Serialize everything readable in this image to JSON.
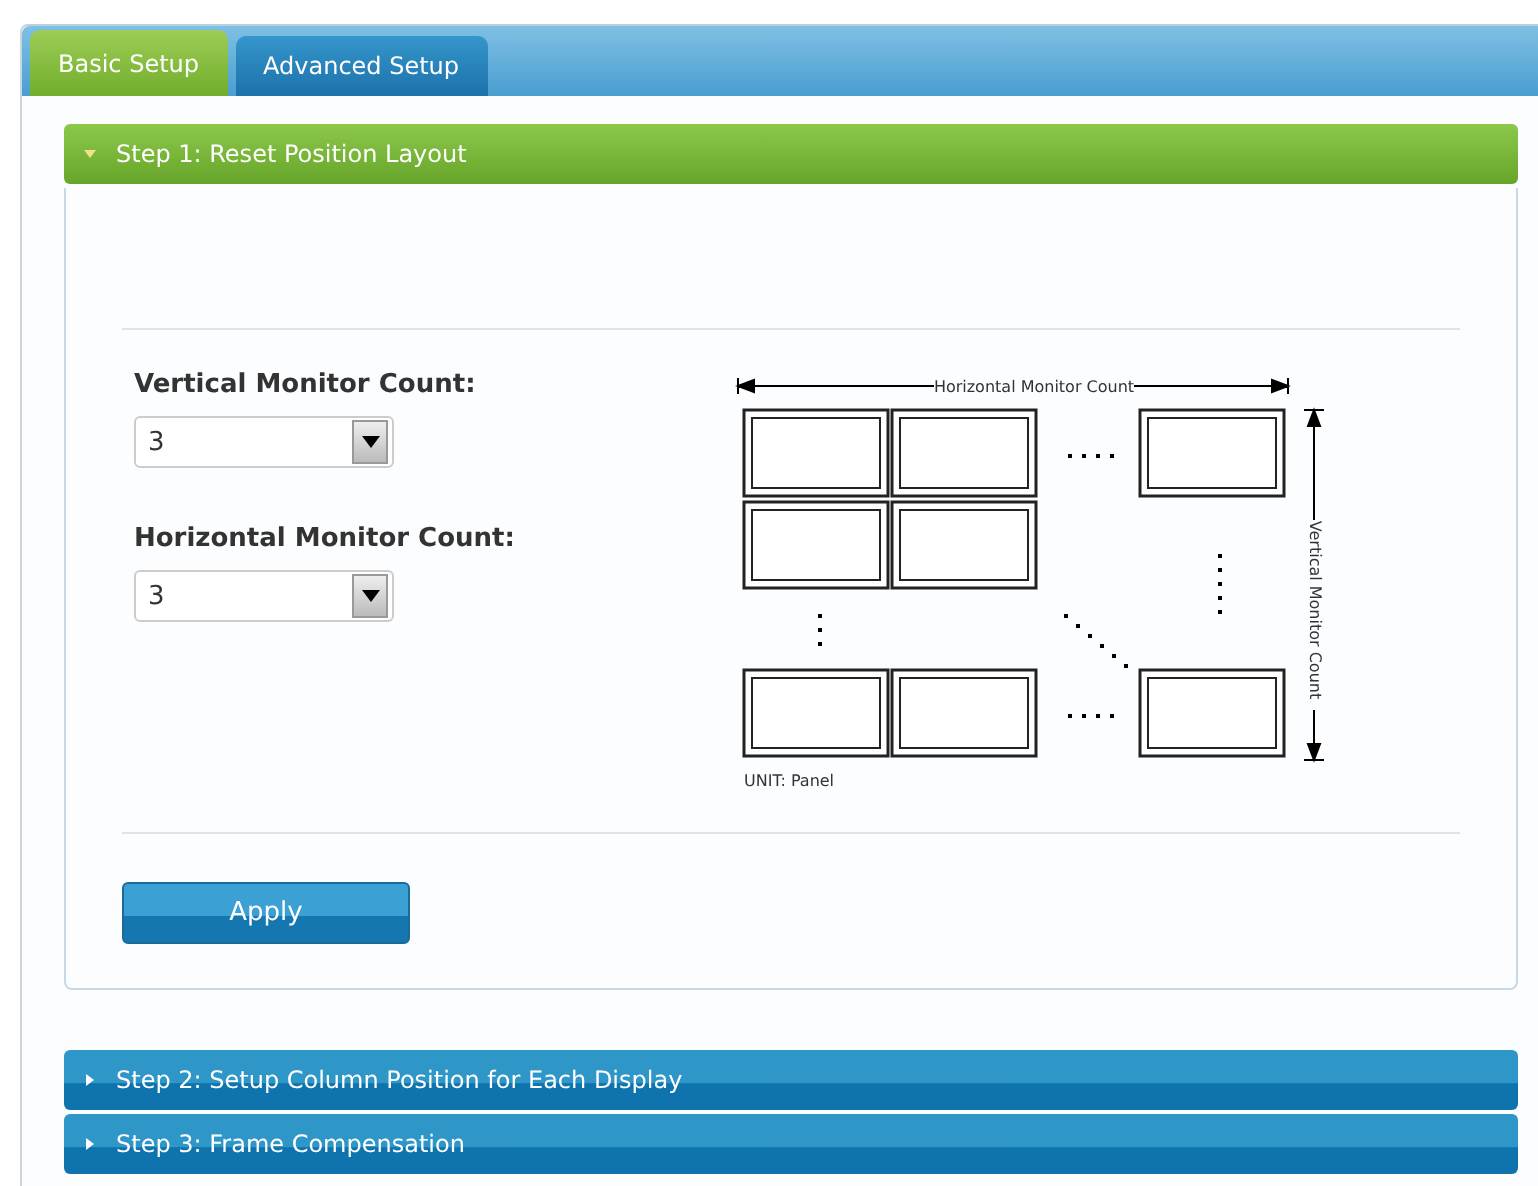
{
  "tabs": [
    {
      "label": "Basic Setup",
      "selected": true
    },
    {
      "label": "Advanced Setup",
      "selected": false
    }
  ],
  "steps": [
    {
      "title": "Step 1: Reset Position Layout",
      "expanded": true
    },
    {
      "title": "Step 2: Setup Column Position for Each Display",
      "expanded": false
    },
    {
      "title": "Step 3: Frame Compensation",
      "expanded": false
    }
  ],
  "fields": [
    {
      "label": "Vertical Monitor Count:",
      "value": "3"
    },
    {
      "label": "Horizontal Monitor Count:",
      "value": "3"
    }
  ],
  "diagram": {
    "horizontal_label": "Horizontal Monitor Count",
    "vertical_label": "Vertical Monitor Count",
    "unit_label": "UNIT: Panel"
  },
  "apply_button": "Apply"
}
